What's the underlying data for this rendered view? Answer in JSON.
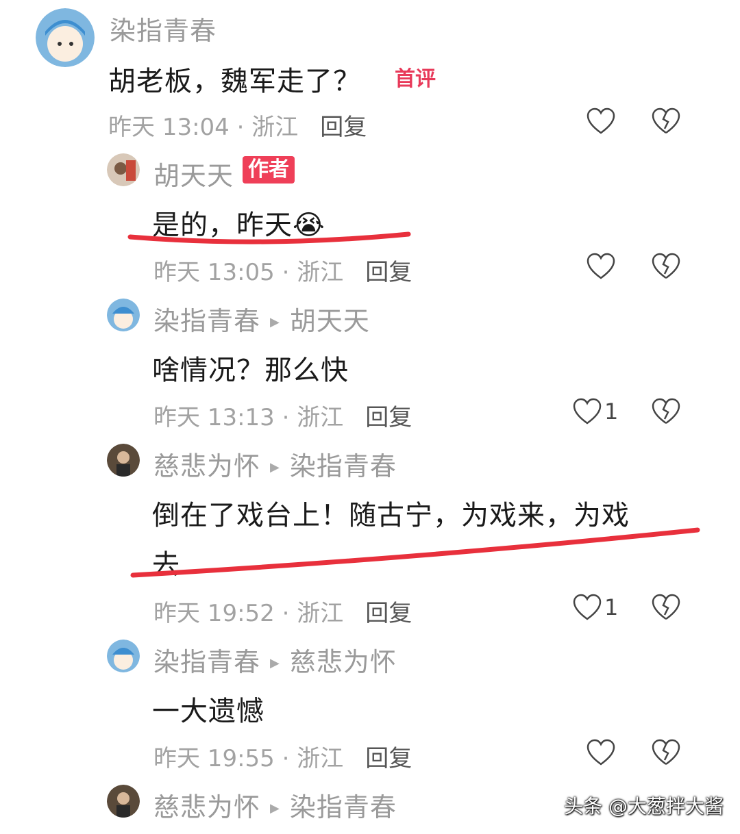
{
  "comments": [
    {
      "user": "染指青春",
      "text": "胡老板，魏军走了？",
      "badge": "首评",
      "time": "昨天 13:04 · 浙江",
      "reply": "回复"
    },
    {
      "user": "胡天天",
      "badge": "作者",
      "text": "是的，昨天😭",
      "time": "昨天 13:05 · 浙江",
      "reply": "回复"
    },
    {
      "user": "染指青春",
      "reply_to": "胡天天",
      "text": "啥情况？那么快",
      "time": "昨天 13:13 · 浙江",
      "reply": "回复",
      "likes": "1"
    },
    {
      "user": "慈悲为怀",
      "reply_to": "染指青春",
      "text_line1": "倒在了戏台上！随古宁，为戏来，为戏",
      "text_line2": "去",
      "time": "昨天 19:52 · 浙江",
      "reply": "回复",
      "likes": "1"
    },
    {
      "user": "染指青春",
      "reply_to": "慈悲为怀",
      "text": "一大遗憾",
      "time": "昨天 19:55 · 浙江",
      "reply": "回复"
    },
    {
      "user": "慈悲为怀",
      "reply_to": "染指青春"
    }
  ],
  "watermark": "头条 @大葱拌大酱",
  "icons": {
    "like": "heart-outline-icon",
    "dislike": "broken-heart-icon",
    "arrow": "reply-arrow-icon"
  },
  "colors": {
    "badge": "#ef3f58",
    "underline": "#e8303c"
  }
}
